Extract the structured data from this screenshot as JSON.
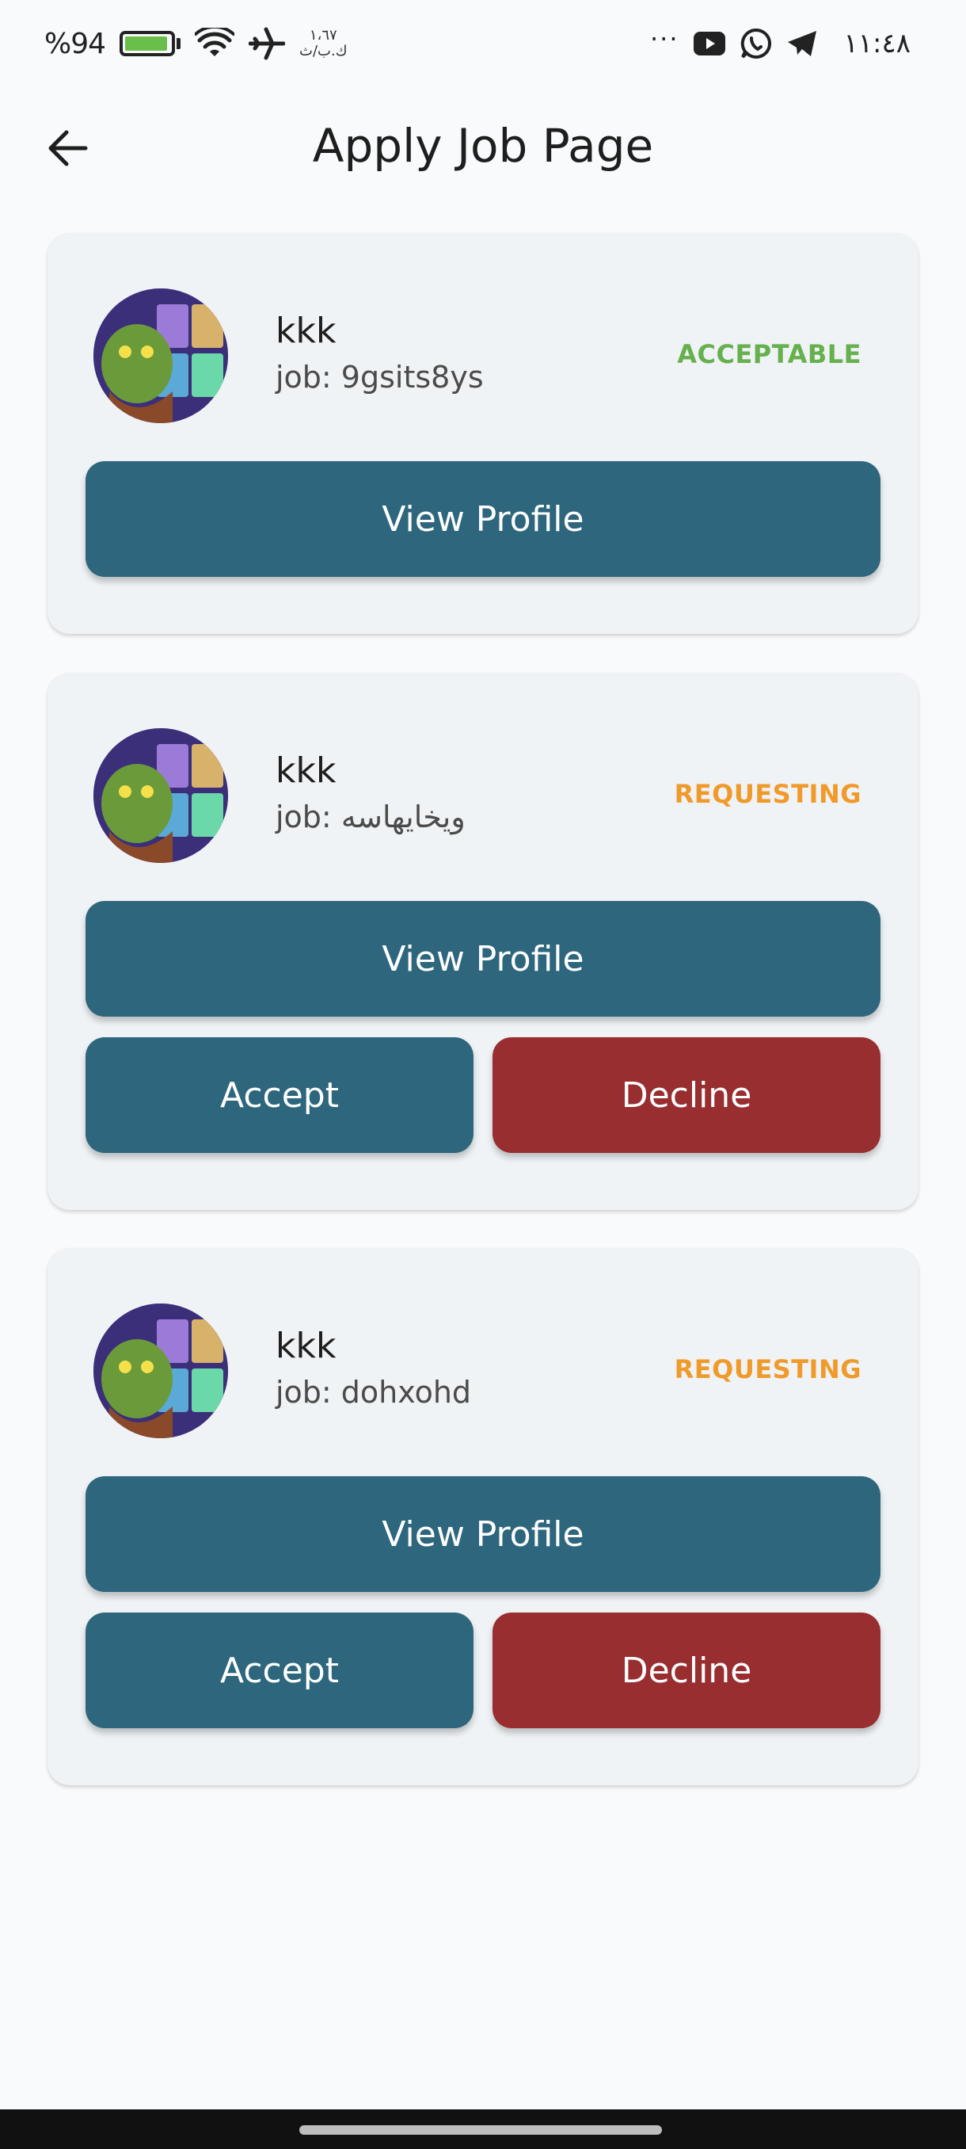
{
  "status_bar": {
    "battery_percent": "%94",
    "network_speed": "١،٦٧",
    "network_unit": "ك.ب/ث",
    "overflow": "···",
    "time": "١١:٤٨",
    "battery_level": 0.94,
    "battery_color": "#6abf4b"
  },
  "app_bar": {
    "title": "Apply Job Page"
  },
  "applications": [
    {
      "name": "kkk",
      "job": "job: 9gsits8ys",
      "status": "ACCEPTABLE",
      "status_color": "#66b04e",
      "view_profile_label": "View Profile"
    },
    {
      "name": "kkk",
      "job": "job: ويخايهاسه",
      "status": "REQUESTING",
      "status_color": "#f09a2b",
      "view_profile_label": "View Profile",
      "accept_label": "Accept",
      "decline_label": "Decline"
    },
    {
      "name": "kkk",
      "job": "job: dohxohd",
      "status": "REQUESTING",
      "status_color": "#f09a2b",
      "view_profile_label": "View Profile",
      "accept_label": "Accept",
      "decline_label": "Decline"
    }
  ],
  "colors": {
    "primary_button": "#2d667d",
    "decline_button": "#982e2f",
    "card_background": "#eff3f5",
    "page_background": "#f8fafc"
  },
  "icons": {
    "back": "arrow-left-icon",
    "wifi": "wifi-icon",
    "airplane": "airplane-icon",
    "youtube": "youtube-icon",
    "whatsapp": "whatsapp-icon",
    "telegram": "telegram-icon",
    "battery": "battery-charging-icon"
  }
}
